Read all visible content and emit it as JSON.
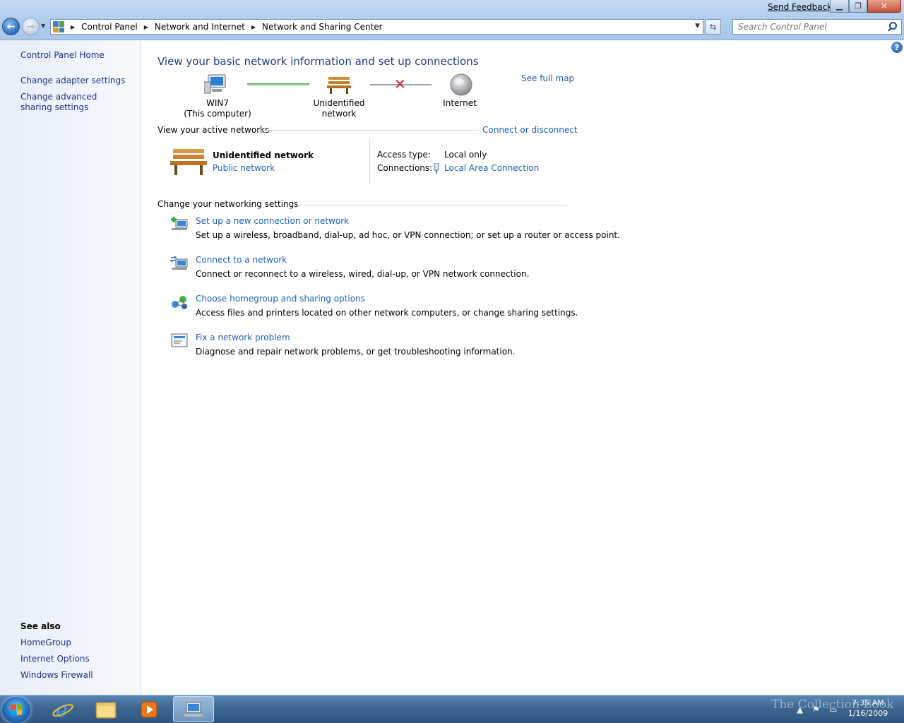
{
  "window": {
    "send_feedback": "Send Feedback"
  },
  "nav": {
    "breadcrumbs": [
      "Control Panel",
      "Network and Internet",
      "Network and Sharing Center"
    ],
    "search_placeholder": "Search Control Panel"
  },
  "sidebar": {
    "home": "Control Panel Home",
    "links": [
      "Change adapter settings",
      "Change advanced sharing settings"
    ],
    "see_also_heading": "See also",
    "see_also": [
      "HomeGroup",
      "Internet Options",
      "Windows Firewall"
    ]
  },
  "main": {
    "title": "View your basic network information and set up connections",
    "see_full_map": "See full map",
    "map": {
      "computer_name": "WIN7",
      "computer_sub": "(This computer)",
      "network": "Unidentified network",
      "internet": "Internet"
    },
    "active": {
      "heading": "View your active networks",
      "connect_link": "Connect or disconnect",
      "network_name": "Unidentified network",
      "network_type": "Public network",
      "access_label": "Access type:",
      "access_value": "Local only",
      "connections_label": "Connections:",
      "connections_value": "Local Area Connection"
    },
    "settings": {
      "heading": "Change your networking settings",
      "tasks": [
        {
          "link": "Set up a new connection or network",
          "desc": "Set up a wireless, broadband, dial-up, ad hoc, or VPN connection; or set up a router or access point."
        },
        {
          "link": "Connect to a network",
          "desc": "Connect or reconnect to a wireless, wired, dial-up, or VPN network connection."
        },
        {
          "link": "Choose homegroup and sharing options",
          "desc": "Access files and printers located on other network computers, or change sharing settings."
        },
        {
          "link": "Fix a network problem",
          "desc": "Diagnose and repair network problems, or get troubleshooting information."
        }
      ]
    }
  },
  "taskbar": {
    "time": "7:35 AM",
    "date": "1/16/2009",
    "watermark": "The Collection Book"
  }
}
